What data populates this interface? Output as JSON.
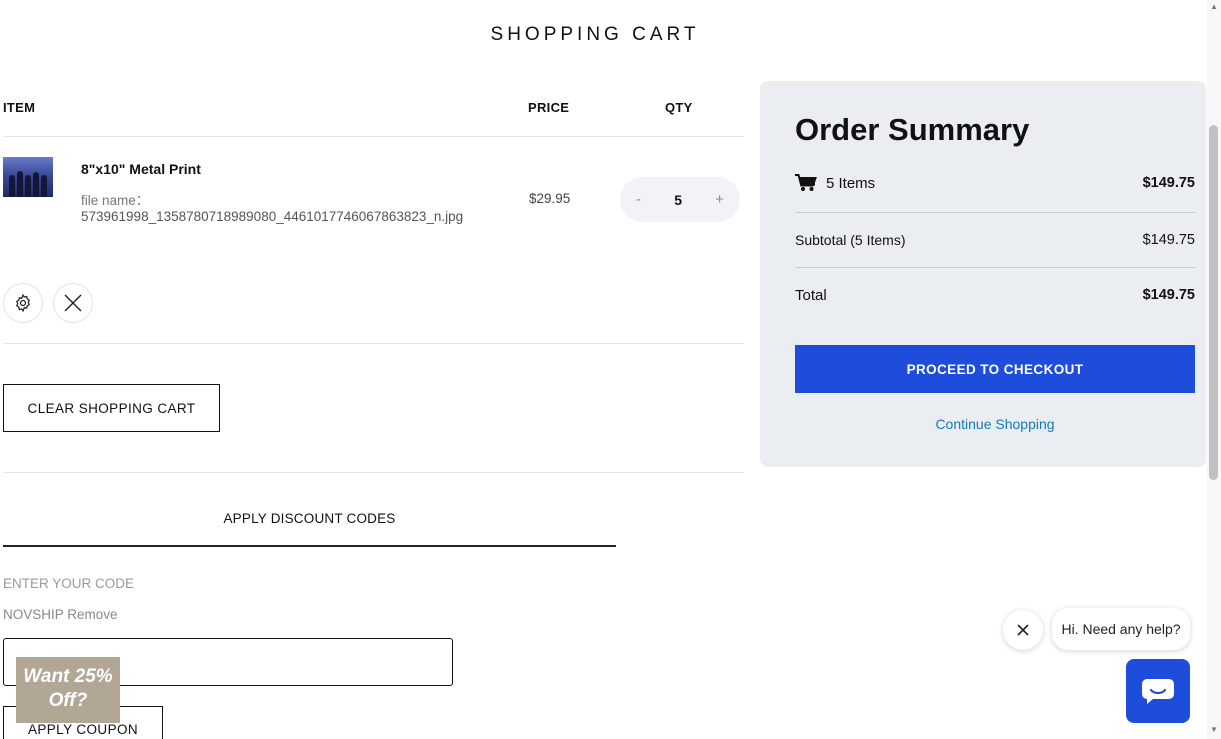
{
  "page": {
    "title": "SHOPPING CART"
  },
  "table": {
    "headers": {
      "item": "ITEM",
      "price": "PRICE",
      "qty": "QTY"
    }
  },
  "cart_item": {
    "name": "8\"x10\" Metal Print",
    "file_label": "file name：",
    "file_name": "573961998_1358780718989080_4461017746067863823_n.jpg",
    "price": "$29.95",
    "qty": "5",
    "qty_minus": "-",
    "qty_plus": "+"
  },
  "actions": {
    "clear_cart": "CLEAR SHOPPING CART"
  },
  "discount": {
    "title": "APPLY DISCOUNT CODES",
    "label": "ENTER YOUR CODE",
    "applied": "NOVSHIP Remove",
    "input_value": "",
    "apply_button": "APPLY COUPON"
  },
  "promo": {
    "text": "Want 25% Off?"
  },
  "summary": {
    "title": "Order Summary",
    "items_count": "5 Items",
    "items_total": "$149.75",
    "subtotal_label": "Subtotal (5 Items)",
    "subtotal_value": "$149.75",
    "total_label": "Total",
    "total_value": "$149.75",
    "checkout_button": "PROCEED TO CHECKOUT",
    "continue_link": "Continue Shopping"
  },
  "chat": {
    "greeting": "Hi. Need any help?"
  },
  "colors": {
    "accent": "#1e4ddb",
    "link": "#1679b8",
    "summary_bg": "#eaedf1",
    "promo_bg": "#b2a795"
  },
  "icons": [
    "gear-icon",
    "close-icon",
    "cart-icon",
    "chat-icon"
  ]
}
